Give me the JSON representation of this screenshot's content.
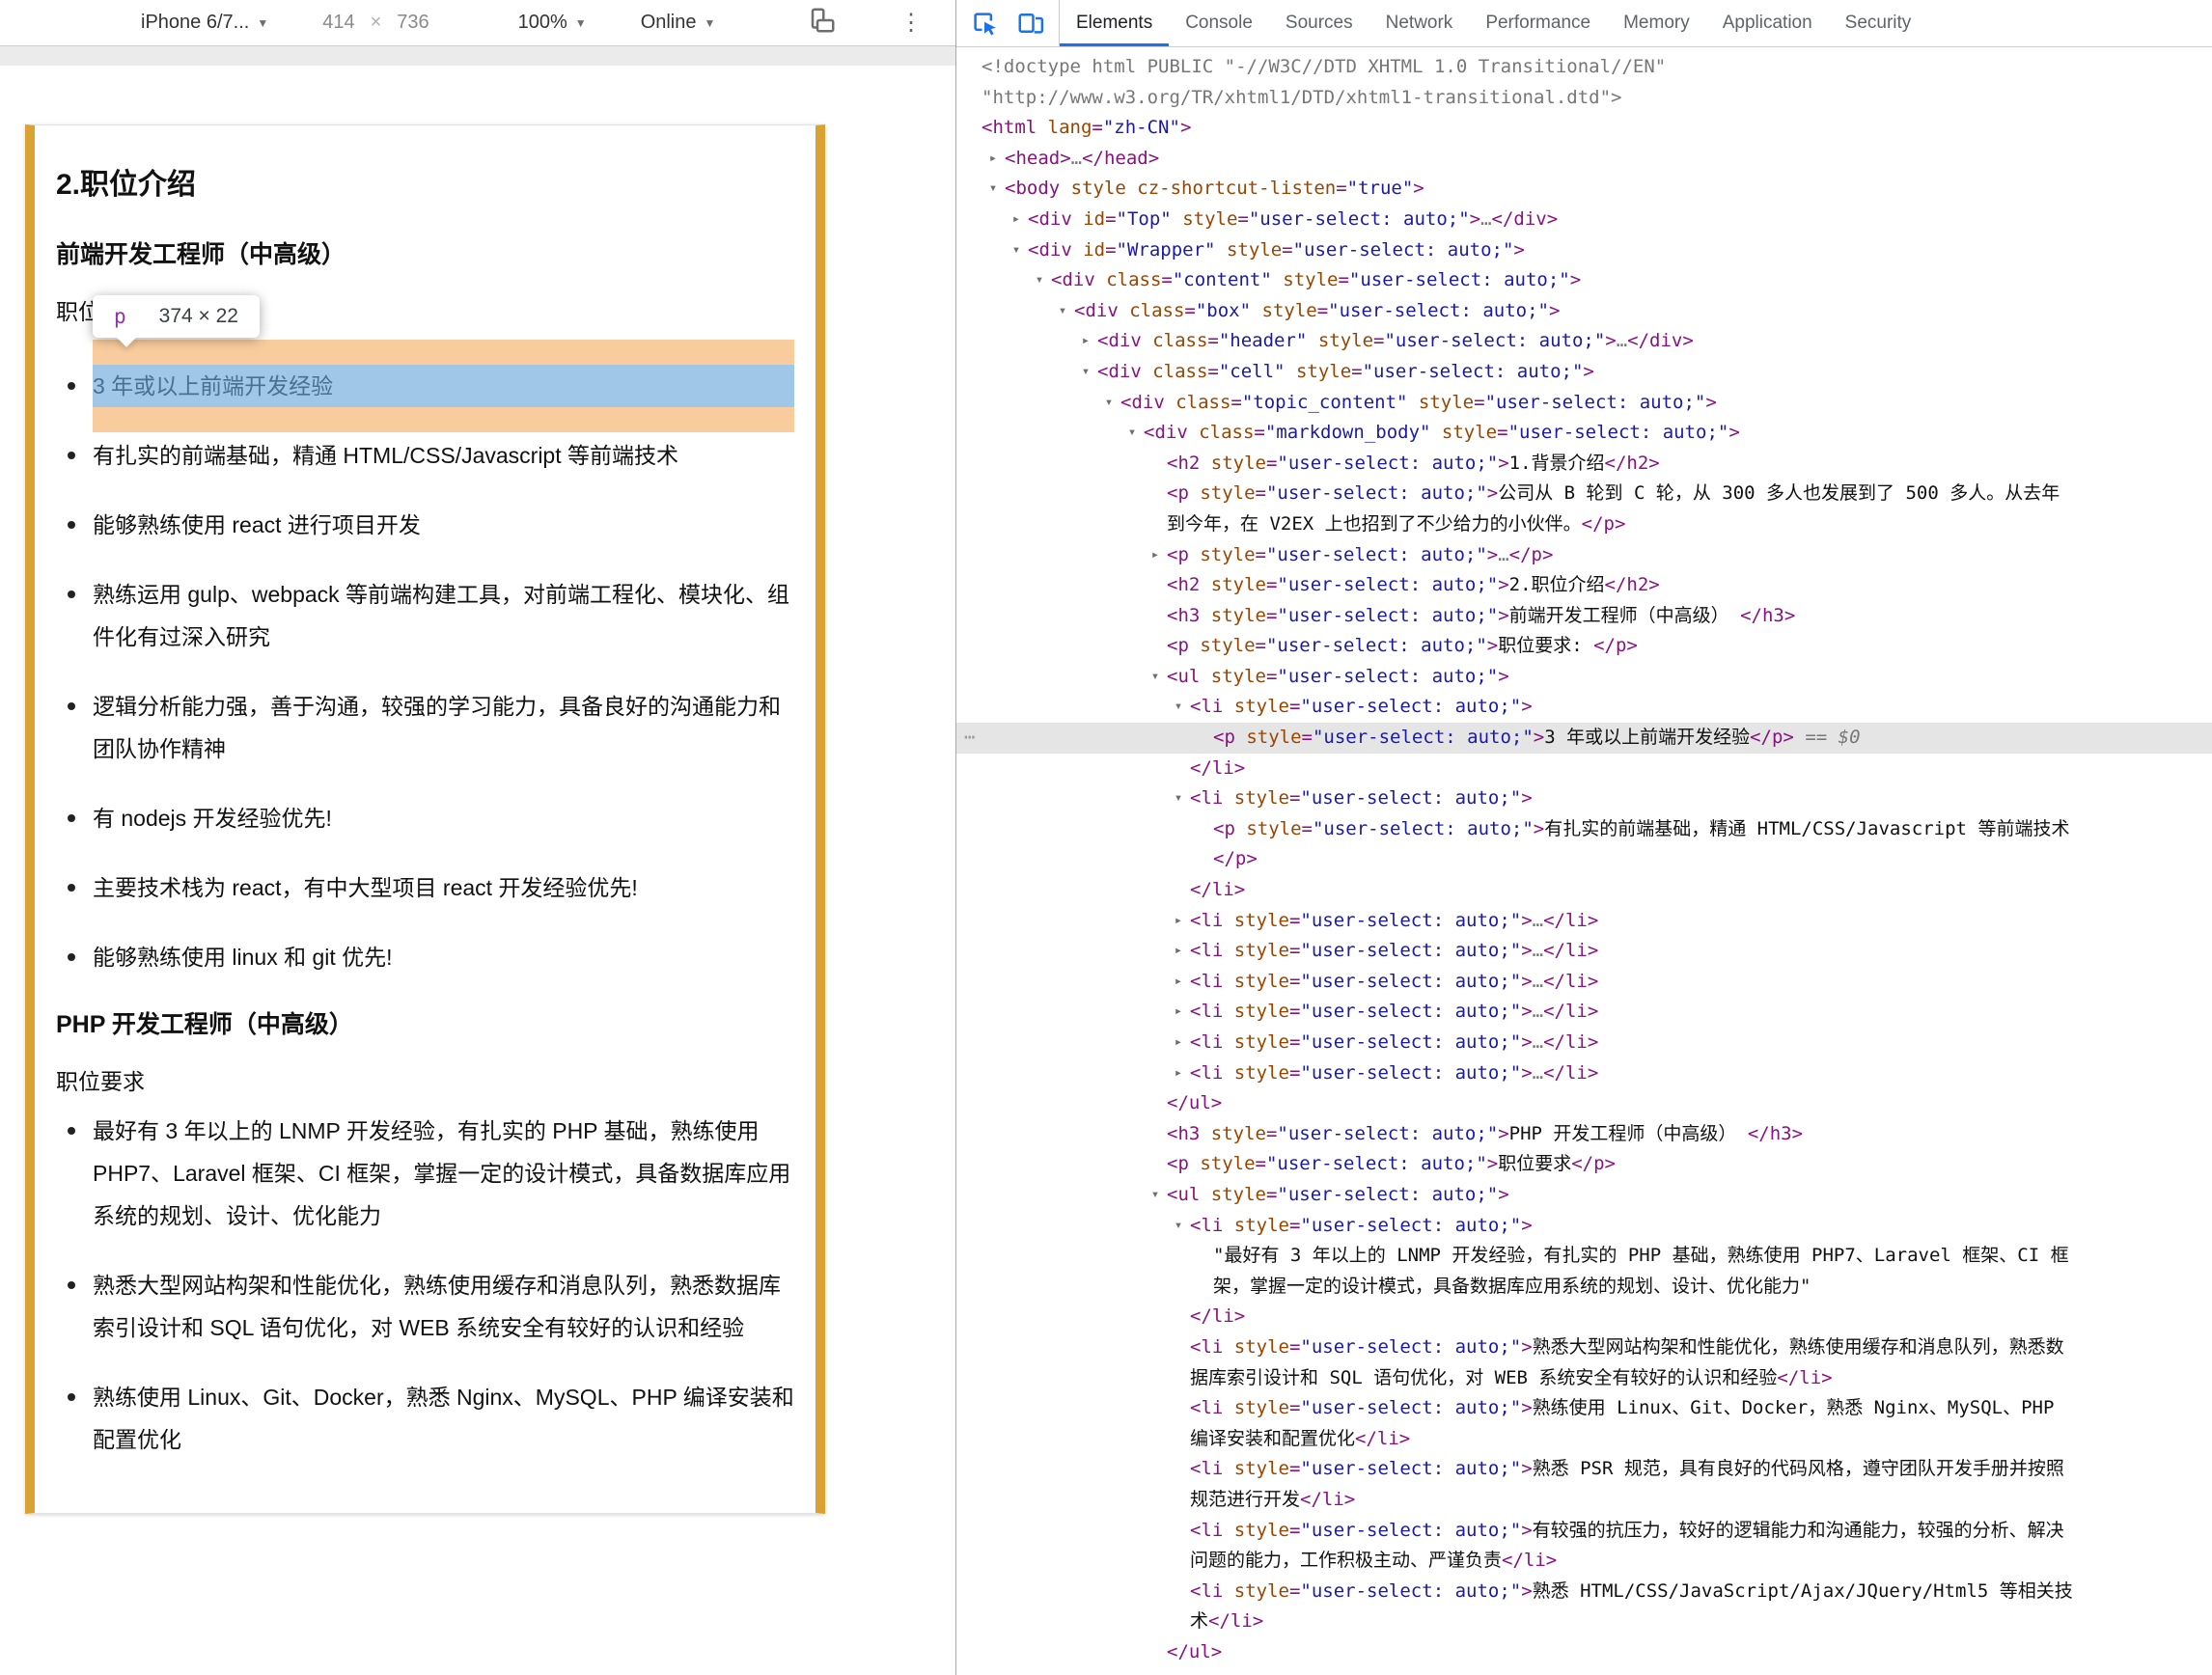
{
  "device_toolbar": {
    "device_label": "iPhone 6/7...",
    "width": "414",
    "times": "×",
    "height": "736",
    "zoom_label": "100%",
    "network_label": "Online"
  },
  "devtools": {
    "tabs": [
      "Elements",
      "Console",
      "Sources",
      "Network",
      "Performance",
      "Memory",
      "Application",
      "Security"
    ],
    "active_tab": "Elements"
  },
  "overlay_tooltip": {
    "tag": "p",
    "size": "374 × 22"
  },
  "page": {
    "section_title": "2.职位介绍",
    "frontend_title": "前端开发工程师（中高级）",
    "frontend_requirements_label": "职位要求:",
    "frontend_highlighted_item": "3 年或以上前端开发经验",
    "frontend_items": [
      "有扎实的前端基础，精通 HTML/CSS/Javascript 等前端技术",
      "能够熟练使用 react 进行项目开发",
      "熟练运用 gulp、webpack 等前端构建工具，对前端工程化、模块化、组件化有过深入研究",
      "逻辑分析能力强，善于沟通，较强的学习能力，具备良好的沟通能力和团队协作精神",
      "有 nodejs 开发经验优先!",
      "主要技术栈为 react，有中大型项目 react 开发经验优先!",
      "能够熟练使用 linux 和 git 优先!"
    ],
    "php_title": "PHP 开发工程师（中高级）",
    "php_requirements_label": "职位要求",
    "php_items": [
      "最好有 3 年以上的 LNMP 开发经验，有扎实的 PHP 基础，熟练使用 PHP7、Laravel 框架、CI 框架，掌握一定的设计模式，具备数据库应用系统的规划、设计、优化能力",
      "熟悉大型网站构架和性能优化，熟练使用缓存和消息队列，熟悉数据库索引设计和 SQL 语句优化，对 WEB 系统安全有较好的认识和经验",
      "熟练使用 Linux、Git、Docker，熟悉 Nginx、MySQL、PHP 编译安装和配置优化"
    ]
  },
  "code": {
    "style_value": "user-select: auto;",
    "lines": [
      {
        "d": 0,
        "tk": [
          [
            "g",
            "<!doctype html PUBLIC \"-//W3C//DTD XHTML 1.0 Transitional//EN\""
          ]
        ]
      },
      {
        "d": 0,
        "tk": [
          [
            "g",
            "\"http://www.w3.org/TR/xhtml1/DTD/xhtml1-transitional.dtd\">"
          ]
        ]
      },
      {
        "d": 0,
        "tk": [
          [
            "t",
            "<html "
          ],
          [
            "a",
            "lang"
          ],
          [
            "t",
            "="
          ],
          [
            "v",
            "\"zh-CN\""
          ],
          [
            "t",
            ">"
          ]
        ]
      },
      {
        "d": 1,
        "a": "c",
        "tk": [
          [
            "t",
            "<head>"
          ],
          [
            "g",
            "…"
          ],
          [
            "t",
            "</head>"
          ]
        ]
      },
      {
        "d": 1,
        "a": "o",
        "tk": [
          [
            "t",
            "<body "
          ],
          [
            "a",
            "style"
          ],
          [
            "t",
            " "
          ],
          [
            "a",
            "cz-shortcut-listen"
          ],
          [
            "t",
            "="
          ],
          [
            "v",
            "\"true\""
          ],
          [
            "t",
            ">"
          ]
        ]
      },
      {
        "d": 2,
        "a": "c",
        "tk": [
          [
            "t",
            "<div "
          ],
          [
            "a",
            "id"
          ],
          [
            "t",
            "="
          ],
          [
            "v",
            "\"Top\""
          ],
          [
            "t",
            " "
          ],
          [
            "s"
          ],
          [
            "t",
            ">"
          ],
          [
            "g",
            "…"
          ],
          [
            "t",
            "</div>"
          ]
        ]
      },
      {
        "d": 2,
        "a": "o",
        "tk": [
          [
            "t",
            "<div "
          ],
          [
            "a",
            "id"
          ],
          [
            "t",
            "="
          ],
          [
            "v",
            "\"Wrapper\""
          ],
          [
            "t",
            " "
          ],
          [
            "s"
          ],
          [
            "t",
            ">"
          ]
        ]
      },
      {
        "d": 3,
        "a": "o",
        "tk": [
          [
            "t",
            "<div "
          ],
          [
            "a",
            "class"
          ],
          [
            "t",
            "="
          ],
          [
            "v",
            "\"content\""
          ],
          [
            "t",
            " "
          ],
          [
            "s"
          ],
          [
            "t",
            ">"
          ]
        ]
      },
      {
        "d": 4,
        "a": "o",
        "tk": [
          [
            "t",
            "<div "
          ],
          [
            "a",
            "class"
          ],
          [
            "t",
            "="
          ],
          [
            "v",
            "\"box\""
          ],
          [
            "t",
            " "
          ],
          [
            "s"
          ],
          [
            "t",
            ">"
          ]
        ]
      },
      {
        "d": 5,
        "a": "c",
        "tk": [
          [
            "t",
            "<div "
          ],
          [
            "a",
            "class"
          ],
          [
            "t",
            "="
          ],
          [
            "v",
            "\"header\""
          ],
          [
            "t",
            " "
          ],
          [
            "s"
          ],
          [
            "t",
            ">"
          ],
          [
            "g",
            "…"
          ],
          [
            "t",
            "</div>"
          ]
        ]
      },
      {
        "d": 5,
        "a": "o",
        "tk": [
          [
            "t",
            "<div "
          ],
          [
            "a",
            "class"
          ],
          [
            "t",
            "="
          ],
          [
            "v",
            "\"cell\""
          ],
          [
            "t",
            " "
          ],
          [
            "s"
          ],
          [
            "t",
            ">"
          ]
        ]
      },
      {
        "d": 6,
        "a": "o",
        "tk": [
          [
            "t",
            "<div "
          ],
          [
            "a",
            "class"
          ],
          [
            "t",
            "="
          ],
          [
            "v",
            "\"topic_content\""
          ],
          [
            "t",
            " "
          ],
          [
            "s"
          ],
          [
            "t",
            ">"
          ]
        ]
      },
      {
        "d": 7,
        "a": "o",
        "tk": [
          [
            "t",
            "<div "
          ],
          [
            "a",
            "class"
          ],
          [
            "t",
            "="
          ],
          [
            "v",
            "\"markdown_body\""
          ],
          [
            "t",
            " "
          ],
          [
            "s"
          ],
          [
            "t",
            ">"
          ]
        ]
      },
      {
        "d": 8,
        "tk": [
          [
            "t",
            "<h2 "
          ],
          [
            "s"
          ],
          [
            "t",
            ">"
          ],
          [
            "x",
            "1.背景介绍"
          ],
          [
            "t",
            "</h2>"
          ]
        ]
      },
      {
        "d": 8,
        "tk": [
          [
            "t",
            "<p "
          ],
          [
            "s"
          ],
          [
            "t",
            ">"
          ],
          [
            "x",
            "公司从 B 轮到 C 轮，从 300 多人也发展到了 500 多人。从去年"
          ]
        ]
      },
      {
        "d": 8,
        "tk": [
          [
            "x",
            "到今年，在 V2EX 上也招到了不少给力的小伙伴。"
          ],
          [
            "t",
            "</p>"
          ]
        ]
      },
      {
        "d": 8,
        "a": "c",
        "tk": [
          [
            "t",
            "<p "
          ],
          [
            "s"
          ],
          [
            "t",
            ">"
          ],
          [
            "g",
            "…"
          ],
          [
            "t",
            "</p>"
          ]
        ]
      },
      {
        "d": 8,
        "tk": [
          [
            "t",
            "<h2 "
          ],
          [
            "s"
          ],
          [
            "t",
            ">"
          ],
          [
            "x",
            "2.职位介绍"
          ],
          [
            "t",
            "</h2>"
          ]
        ]
      },
      {
        "d": 8,
        "tk": [
          [
            "t",
            "<h3 "
          ],
          [
            "s"
          ],
          [
            "t",
            ">"
          ],
          [
            "x",
            "前端开发工程师（中高级） "
          ],
          [
            "t",
            "</h3>"
          ]
        ]
      },
      {
        "d": 8,
        "tk": [
          [
            "t",
            "<p "
          ],
          [
            "s"
          ],
          [
            "t",
            ">"
          ],
          [
            "x",
            "职位要求: "
          ],
          [
            "t",
            "</p>"
          ]
        ]
      },
      {
        "d": 8,
        "a": "o",
        "tk": [
          [
            "t",
            "<ul "
          ],
          [
            "s"
          ],
          [
            "t",
            ">"
          ]
        ]
      },
      {
        "d": 9,
        "a": "o",
        "tk": [
          [
            "t",
            "<li "
          ],
          [
            "s"
          ],
          [
            "t",
            ">"
          ]
        ]
      },
      {
        "d": 10,
        "sel": true,
        "dots": true,
        "tk": [
          [
            "t",
            "<p "
          ],
          [
            "s"
          ],
          [
            "t",
            ">"
          ],
          [
            "x",
            "3 年或以上前端开发经验"
          ],
          [
            "t",
            "</p>"
          ],
          [
            "g",
            " == "
          ],
          [
            "i",
            "$0"
          ]
        ]
      },
      {
        "d": 9,
        "tk": [
          [
            "t",
            "</li>"
          ]
        ]
      },
      {
        "d": 9,
        "a": "o",
        "tk": [
          [
            "t",
            "<li "
          ],
          [
            "s"
          ],
          [
            "t",
            ">"
          ]
        ]
      },
      {
        "d": 10,
        "tk": [
          [
            "t",
            "<p "
          ],
          [
            "s"
          ],
          [
            "t",
            ">"
          ],
          [
            "x",
            "有扎实的前端基础，精通 HTML/CSS/Javascript 等前端技术"
          ]
        ]
      },
      {
        "d": 10,
        "tk": [
          [
            "t",
            "</p>"
          ]
        ]
      },
      {
        "d": 9,
        "tk": [
          [
            "t",
            "</li>"
          ]
        ]
      },
      {
        "d": 9,
        "a": "c",
        "tk": [
          [
            "t",
            "<li "
          ],
          [
            "s"
          ],
          [
            "t",
            ">"
          ],
          [
            "g",
            "…"
          ],
          [
            "t",
            "</li>"
          ]
        ]
      },
      {
        "d": 9,
        "a": "c",
        "tk": [
          [
            "t",
            "<li "
          ],
          [
            "s"
          ],
          [
            "t",
            ">"
          ],
          [
            "g",
            "…"
          ],
          [
            "t",
            "</li>"
          ]
        ]
      },
      {
        "d": 9,
        "a": "c",
        "tk": [
          [
            "t",
            "<li "
          ],
          [
            "s"
          ],
          [
            "t",
            ">"
          ],
          [
            "g",
            "…"
          ],
          [
            "t",
            "</li>"
          ]
        ]
      },
      {
        "d": 9,
        "a": "c",
        "tk": [
          [
            "t",
            "<li "
          ],
          [
            "s"
          ],
          [
            "t",
            ">"
          ],
          [
            "g",
            "…"
          ],
          [
            "t",
            "</li>"
          ]
        ]
      },
      {
        "d": 9,
        "a": "c",
        "tk": [
          [
            "t",
            "<li "
          ],
          [
            "s"
          ],
          [
            "t",
            ">"
          ],
          [
            "g",
            "…"
          ],
          [
            "t",
            "</li>"
          ]
        ]
      },
      {
        "d": 9,
        "a": "c",
        "tk": [
          [
            "t",
            "<li "
          ],
          [
            "s"
          ],
          [
            "t",
            ">"
          ],
          [
            "g",
            "…"
          ],
          [
            "t",
            "</li>"
          ]
        ]
      },
      {
        "d": 8,
        "tk": [
          [
            "t",
            "</ul>"
          ]
        ]
      },
      {
        "d": 8,
        "tk": [
          [
            "t",
            "<h3 "
          ],
          [
            "s"
          ],
          [
            "t",
            ">"
          ],
          [
            "x",
            "PHP 开发工程师（中高级） "
          ],
          [
            "t",
            "</h3>"
          ]
        ]
      },
      {
        "d": 8,
        "tk": [
          [
            "t",
            "<p "
          ],
          [
            "s"
          ],
          [
            "t",
            ">"
          ],
          [
            "x",
            "职位要求"
          ],
          [
            "t",
            "</p>"
          ]
        ]
      },
      {
        "d": 8,
        "a": "o",
        "tk": [
          [
            "t",
            "<ul "
          ],
          [
            "s"
          ],
          [
            "t",
            ">"
          ]
        ]
      },
      {
        "d": 9,
        "a": "o",
        "tk": [
          [
            "t",
            "<li "
          ],
          [
            "s"
          ],
          [
            "t",
            ">"
          ]
        ]
      },
      {
        "d": 10,
        "tk": [
          [
            "x",
            "\"最好有 3 年以上的 LNMP 开发经验，有扎实的 PHP 基础，熟练使用 PHP7、Laravel 框架、CI 框"
          ]
        ]
      },
      {
        "d": 10,
        "tk": [
          [
            "x",
            "架，掌握一定的设计模式，具备数据库应用系统的规划、设计、优化能力\""
          ]
        ]
      },
      {
        "d": 9,
        "tk": [
          [
            "t",
            "</li>"
          ]
        ]
      },
      {
        "d": 9,
        "tk": [
          [
            "t",
            "<li "
          ],
          [
            "s"
          ],
          [
            "t",
            ">"
          ],
          [
            "x",
            "熟悉大型网站构架和性能优化，熟练使用缓存和消息队列，熟悉数"
          ]
        ]
      },
      {
        "d": 9,
        "tk": [
          [
            "x",
            "据库索引设计和 SQL 语句优化，对 WEB 系统安全有较好的认识和经验"
          ],
          [
            "t",
            "</li>"
          ]
        ]
      },
      {
        "d": 9,
        "tk": [
          [
            "t",
            "<li "
          ],
          [
            "s"
          ],
          [
            "t",
            ">"
          ],
          [
            "x",
            "熟练使用 Linux、Git、Docker，熟悉 Nginx、MySQL、PHP"
          ]
        ]
      },
      {
        "d": 9,
        "tk": [
          [
            "x",
            "编译安装和配置优化"
          ],
          [
            "t",
            "</li>"
          ]
        ]
      },
      {
        "d": 9,
        "tk": [
          [
            "t",
            "<li "
          ],
          [
            "s"
          ],
          [
            "t",
            ">"
          ],
          [
            "x",
            "熟悉 PSR 规范，具有良好的代码风格，遵守团队开发手册并按照"
          ]
        ]
      },
      {
        "d": 9,
        "tk": [
          [
            "x",
            "规范进行开发"
          ],
          [
            "t",
            "</li>"
          ]
        ]
      },
      {
        "d": 9,
        "tk": [
          [
            "t",
            "<li "
          ],
          [
            "s"
          ],
          [
            "t",
            ">"
          ],
          [
            "x",
            "有较强的抗压力，较好的逻辑能力和沟通能力，较强的分析、解决"
          ]
        ]
      },
      {
        "d": 9,
        "tk": [
          [
            "x",
            "问题的能力，工作积极主动、严谨负责"
          ],
          [
            "t",
            "</li>"
          ]
        ]
      },
      {
        "d": 9,
        "tk": [
          [
            "t",
            "<li "
          ],
          [
            "s"
          ],
          [
            "t",
            ">"
          ],
          [
            "x",
            "熟悉 HTML/CSS/JavaScript/Ajax/JQuery/Html5 等相关技"
          ]
        ]
      },
      {
        "d": 9,
        "tk": [
          [
            "x",
            "术"
          ],
          [
            "t",
            "</li>"
          ]
        ]
      },
      {
        "d": 8,
        "tk": [
          [
            "t",
            "</ul>"
          ]
        ]
      }
    ]
  }
}
